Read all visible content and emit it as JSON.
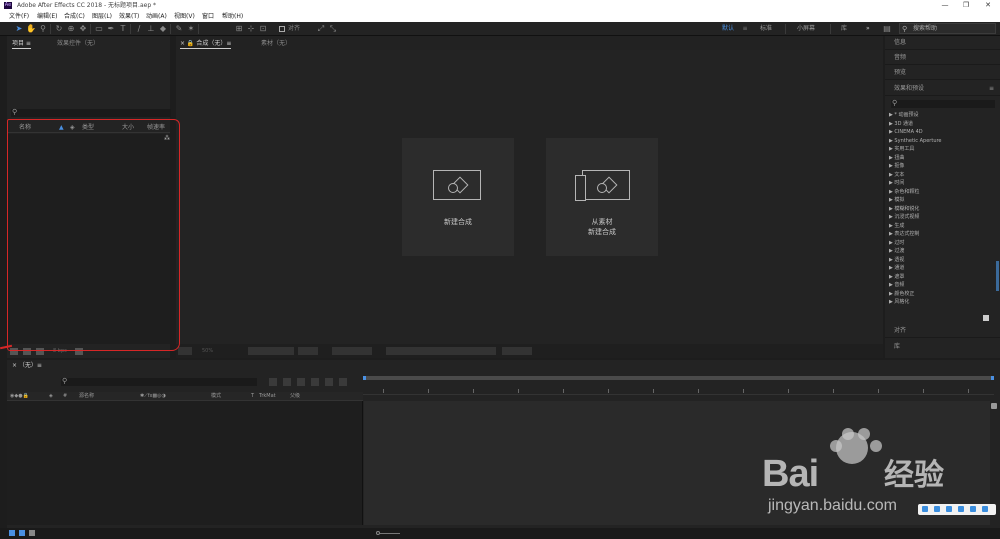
{
  "window": {
    "title": "Adobe After Effects CC 2018 - 无标题项目.aep *",
    "logo_text": "Ae",
    "minimize": "—",
    "maximize": "❐",
    "close": "✕"
  },
  "menu": [
    "文件(F)",
    "编辑(E)",
    "合成(C)",
    "图层(L)",
    "效果(T)",
    "动画(A)",
    "视图(V)",
    "窗口",
    "帮助(H)"
  ],
  "toolbar": {
    "align_label": "对齐",
    "workspaces": [
      "默认",
      "标准",
      "小屏幕",
      "库"
    ],
    "more": "»",
    "search_placeholder": "搜索帮助",
    "accent": "#4a90e2"
  },
  "project": {
    "tabs": [
      "项目 ≡",
      "效果控件（无）"
    ],
    "columns": [
      "名称",
      "类型",
      "大小",
      "帧速率"
    ],
    "bpc": "8 bpc"
  },
  "comp": {
    "tabs": [
      "× 🔒 合成（无）≡",
      "素材（无）"
    ],
    "new_comp_label": "新建合成",
    "from_footage_label_1": "从素材",
    "from_footage_label_2": "新建合成",
    "zoom": "50%"
  },
  "right": {
    "info": "信息",
    "audio": "音频",
    "preview": "预览",
    "effects_title": "效果和预设",
    "menu_icon": "≡",
    "effects": [
      "▶ * 动画预设",
      "▶ 3D 通道",
      "▶ CINEMA 4D",
      "▶ Synthetic Aperture",
      "▶ 实用工具",
      "▶ 扭曲",
      "▶ 抠像",
      "▶ 文本",
      "▶ 时间",
      "▶ 杂色和颗粒",
      "▶ 模拟",
      "▶ 模糊和锐化",
      "▶ 沉浸式视频",
      "▶ 生成",
      "▶ 表达式控制",
      "▶ 过时",
      "▶ 过渡",
      "▶ 透视",
      "▶ 通道",
      "▶ 遮罩",
      "▶ 音频",
      "▶ 颜色校正",
      "▶ 风格化"
    ],
    "align": "对齐",
    "library": "库"
  },
  "timeline": {
    "tab": "× （无）≡",
    "cols": [
      "源名称",
      "模式",
      "T",
      "TrkMat",
      "父级"
    ]
  },
  "watermark": {
    "brand": "Bai",
    "brand_cn": "经验",
    "url": "jingyan.baidu.com"
  }
}
